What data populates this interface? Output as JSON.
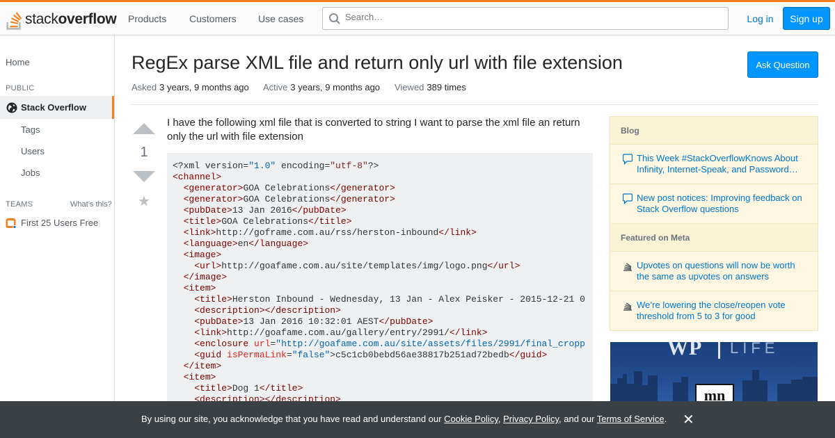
{
  "header": {
    "logo_text_light": "stack",
    "logo_text_bold": "overflow",
    "nav": [
      "Products",
      "Customers",
      "Use cases"
    ],
    "search_placeholder": "Search…",
    "login_label": "Log in",
    "signup_label": "Sign up"
  },
  "leftnav": {
    "home": "Home",
    "public": "PUBLIC",
    "stack_overflow": "Stack Overflow",
    "tags": "Tags",
    "users": "Users",
    "jobs": "Jobs",
    "teams": "TEAMS",
    "whats_this": "What’s this?",
    "first_25": "First 25 Users Free"
  },
  "question": {
    "title": "RegEx parse XML file and return only url with file extension",
    "ask_label": "Ask Question",
    "asked_key": "Asked",
    "asked_val": "3 years, 9 months ago",
    "active_key": "Active",
    "active_val": "3 years, 9 months ago",
    "viewed_key": "Viewed",
    "viewed_val": "389 times",
    "votes": "1",
    "body": "I have the following xml file that is converted to string I want to parse the xml file an return only the url with file extension"
  },
  "sidebar": {
    "blog_head": "Blog",
    "blog_items": [
      "This Week #StackOverflowKnows About Infinity, Internet-Speak, and Password…",
      "New post notices: Improving feedback on Stack Overflow questions"
    ],
    "meta_head": "Featured on Meta",
    "meta_items": [
      "Upvotes on questions will now be worth the same as upvotes on answers",
      "We’re lowering the close/reopen vote threshold from 5 to 3 for good"
    ]
  },
  "cookie": {
    "prefix": "By using our site, you acknowledge that you have read and understand our ",
    "cookie_policy": "Cookie Policy",
    "sep": ", ",
    "privacy_policy": "Privacy Policy",
    "and_our": ", and our ",
    "terms": "Terms of Service",
    "suffix": "."
  },
  "colors": {
    "accent": "#f48024",
    "link": "#0077cc",
    "button": "#0095ff"
  }
}
